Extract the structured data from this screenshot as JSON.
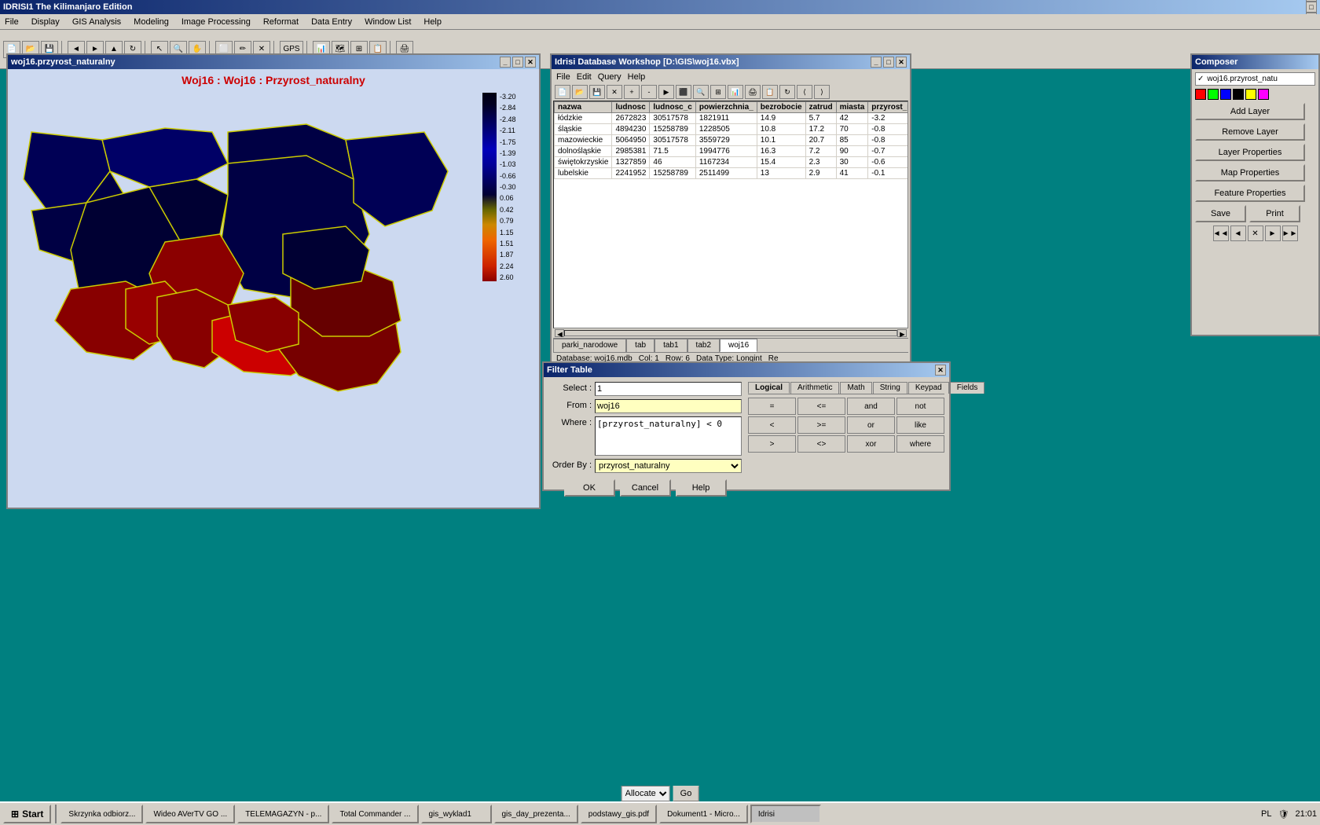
{
  "app": {
    "title": "IDRISI1   The Kilimanjaro Edition",
    "title_buttons": [
      "_",
      "□",
      "✕"
    ]
  },
  "menubar": {
    "items": [
      "File",
      "Display",
      "GIS Analysis",
      "Modeling",
      "Image Processing",
      "Reformat",
      "Data Entry",
      "Window List",
      "Help"
    ]
  },
  "map_window": {
    "title": "woj16.przyrost_naturalny",
    "map_title": "Woj16 : Woj16 : Przyrost_naturalny",
    "legend_values": [
      "-3.20",
      "-2.84",
      "-2.48",
      "-2.11",
      "-1.75",
      "-1.39",
      "-1.03",
      "-0.66",
      "-0.30",
      "0.06",
      "0.42",
      "0.79",
      "1.15",
      "1.51",
      "1.87",
      "2.24",
      "2.60"
    ]
  },
  "db_window": {
    "title": "Idrisi Database Workshop [D:\\GIS\\woj16.vbx]",
    "menu": [
      "File",
      "Edit",
      "Query",
      "Help"
    ],
    "columns": [
      "nazwa",
      "ludnosc",
      "ludnosc_c",
      "powierzchnia_",
      "bezrobocie",
      "zatrud",
      "miasta",
      "przyrost_naturalny"
    ],
    "rows": [
      [
        "łódzkie",
        "2672823",
        "30517578",
        "1821911",
        "14.9",
        "5.7",
        "42",
        "-3.2"
      ],
      [
        "śląskie",
        "4894230",
        "15258789",
        "1228505",
        "10.8",
        "17.2",
        "70",
        "-0.8"
      ],
      [
        "mazowieckie",
        "5064950",
        "30517578",
        "3559729",
        "10.1",
        "20.7",
        "85",
        "-0.8"
      ],
      [
        "dolnośląskie",
        "2985381",
        "71.5",
        "1994776",
        "16.3",
        "7.2",
        "90",
        "-0.7"
      ],
      [
        "świętokrzyskie",
        "1327859",
        "46",
        "1167234",
        "15.4",
        "2.3",
        "30",
        "-0.6"
      ],
      [
        "lubelskie",
        "2241952",
        "15258789",
        "2511499",
        "13",
        "2.9",
        "41",
        "-0.1"
      ]
    ],
    "tabs": [
      "parki_narodowe",
      "tab",
      "tab1",
      "tab2",
      "woj16"
    ],
    "active_tab": "woj16",
    "statusbar": {
      "database": "Database: woj16.mdb",
      "col": "Col: 1",
      "row": "Row: 6",
      "datatype": "Data Type: Longint",
      "re": "Re"
    }
  },
  "filter_dialog": {
    "title": "Filter Table",
    "select_label": "Select :",
    "select_value": "1",
    "from_label": "From :",
    "from_value": "woj16",
    "where_label": "Where :",
    "where_value": "[przyrost_naturalny] < 0",
    "orderby_label": "Order By :",
    "orderby_value": "przyrost_naturalny",
    "tabs": [
      "Logical",
      "Arithmetic",
      "Math",
      "String",
      "Keypad",
      "Fields"
    ],
    "active_tab": "Logical",
    "logical_btns": [
      "=",
      "<=",
      "and",
      "not",
      "<",
      ">=",
      "or",
      "like",
      ">",
      "<>",
      "xor",
      "where"
    ],
    "action_btns": [
      "OK",
      "Cancel",
      "Help"
    ]
  },
  "composer_window": {
    "title": "Composer",
    "layer_name": "woj16.przyrost_natu",
    "color_swatches": [
      "#ff0000",
      "#00ff00",
      "#0000ff",
      "#000000",
      "#ffff00",
      "#ff00ff"
    ],
    "buttons": [
      "Add Layer",
      "Remove Layer",
      "Layer Properties",
      "Map Properties",
      "Feature Properties",
      "Save",
      "Print"
    ],
    "nav_btns": [
      "◄",
      "◄",
      "✕",
      "►",
      "►"
    ]
  },
  "taskbar": {
    "start_label": "Start",
    "items": [
      {
        "label": "Skrzynka odbiorz...",
        "active": false
      },
      {
        "label": "Wideo AVerTV GO ...",
        "active": false
      },
      {
        "label": "TELEMAGAZYN - p...",
        "active": false
      },
      {
        "label": "Total Commander ...",
        "active": false
      },
      {
        "label": "gis_wyklad1",
        "active": false
      },
      {
        "label": "gis_day_prezenta...",
        "active": false
      },
      {
        "label": "podstawy_gis.pdf",
        "active": false
      },
      {
        "label": "Dokument1 - Micro...",
        "active": false
      },
      {
        "label": "Idrisi",
        "active": true
      }
    ],
    "clock": "21:01",
    "lang": "PL"
  },
  "allocate": {
    "label": "Allocate",
    "go_label": "Go"
  }
}
